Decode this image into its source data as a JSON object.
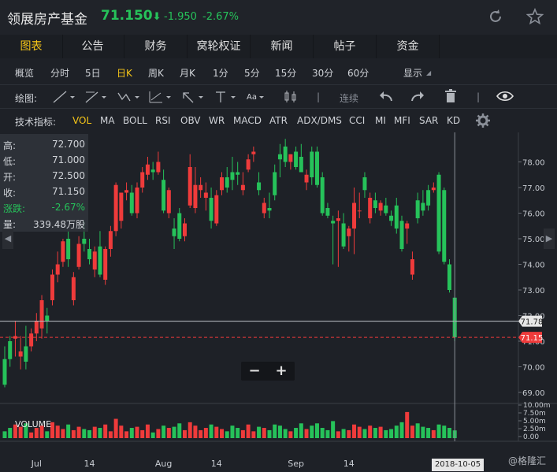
{
  "header": {
    "name": "领展房产基金",
    "price": "71.150",
    "arrow": "⬇",
    "change": "-1.950",
    "change_pct": "-2.67%",
    "refresh_icon": "refresh-icon",
    "star_icon": "star-icon"
  },
  "tabs": [
    {
      "label": "图表",
      "active": true
    },
    {
      "label": "公告"
    },
    {
      "label": "财务"
    },
    {
      "label": "窝轮权证"
    },
    {
      "label": "新闻"
    },
    {
      "label": "帖子"
    },
    {
      "label": "资金"
    }
  ],
  "periods": [
    "概览",
    "分时",
    "5日",
    "日K",
    "周K",
    "月K",
    "1分",
    "5分",
    "15分",
    "30分",
    "60分",
    "显示"
  ],
  "active_period": "日K",
  "draw_toolbar": {
    "label": "绘图:",
    "aa": "Aa",
    "lianxu": "连续"
  },
  "indicators": {
    "label": "技术指标:",
    "items": [
      "VOL",
      "MA",
      "BOLL",
      "RSI",
      "OBV",
      "WR",
      "MACD",
      "ATR",
      "ADX/DMS",
      "CCI",
      "MI",
      "MFI",
      "SAR",
      "KD"
    ],
    "active": "VOL"
  },
  "info": {
    "high_label": "高:",
    "high": "72.700",
    "low_label": "低:",
    "low": "71.000",
    "open_label": "开:",
    "open": "72.500",
    "close_label": "收:",
    "close": "71.150",
    "chg_label": "涨跌:",
    "chg": "-2.67%",
    "vol_label": "量:",
    "vol": "339.48万股"
  },
  "zoom": {
    "minus": "−",
    "plus": "+"
  },
  "volume_label": "VOLUME",
  "crosshair_date": "2018-10-05",
  "watermark": "@格隆汇",
  "colors": {
    "up": "#ef3b3b",
    "down": "#26c25a",
    "accent": "#f5c518",
    "bg": "#1e2127"
  },
  "chart_data": {
    "type": "candlestick",
    "y_ticks": [
      "78.00",
      "77.00",
      "76.00",
      "75.00",
      "74.00",
      "73.00",
      "72.00",
      "71.00",
      "70.00",
      "69.00"
    ],
    "ylim": [
      68.6,
      79.0
    ],
    "price_tags": [
      {
        "value": "71.78",
        "style": "gray"
      },
      {
        "value": "71.15",
        "style": "red"
      }
    ],
    "vol_ticks": [
      "10.00m",
      "7.50m",
      "5.00m",
      "2.50m",
      "0.00"
    ],
    "x_ticks": [
      {
        "label": "Jul",
        "i": 6
      },
      {
        "label": "14",
        "i": 16
      },
      {
        "label": "Aug",
        "i": 30
      },
      {
        "label": "14",
        "i": 40
      },
      {
        "label": "Sep",
        "i": 55
      },
      {
        "label": "14",
        "i": 65
      },
      {
        "label": "14",
        "i": 88
      }
    ],
    "candles": [
      [
        70.3,
        70.8,
        69.2,
        69.3,
        3.0
      ],
      [
        71.0,
        71.2,
        70.0,
        70.3,
        4.5
      ],
      [
        71.1,
        71.8,
        70.4,
        71.2,
        6.0
      ],
      [
        70.4,
        71.2,
        69.9,
        70.6,
        5.0
      ],
      [
        70.8,
        71.6,
        69.9,
        70.2,
        6.5
      ],
      [
        70.8,
        71.5,
        70.6,
        71.3,
        2.5
      ],
      [
        71.3,
        72.1,
        71.0,
        71.8,
        4.5
      ],
      [
        71.5,
        72.8,
        71.1,
        72.6,
        5.5
      ],
      [
        72.0,
        72.3,
        71.3,
        71.8,
        3.0
      ],
      [
        72.6,
        73.8,
        72.4,
        73.6,
        7.0
      ],
      [
        73.6,
        74.5,
        73.3,
        74.0,
        5.5
      ],
      [
        74.1,
        75.0,
        73.9,
        74.9,
        4.0
      ],
      [
        75.0,
        75.3,
        73.9,
        74.2,
        6.0
      ],
      [
        72.6,
        73.7,
        72.4,
        73.5,
        3.5
      ],
      [
        73.9,
        75.1,
        73.8,
        74.8,
        5.0
      ],
      [
        75.0,
        75.7,
        74.5,
        74.8,
        4.0
      ],
      [
        74.6,
        75.0,
        74.0,
        74.2,
        3.5
      ],
      [
        73.8,
        74.7,
        73.5,
        74.5,
        5.0
      ],
      [
        74.7,
        75.3,
        73.5,
        73.6,
        4.5
      ],
      [
        73.4,
        74.7,
        73.2,
        74.6,
        6.0
      ],
      [
        74.6,
        75.5,
        74.3,
        75.3,
        3.0
      ],
      [
        75.3,
        77.2,
        75.1,
        77.1,
        8.5
      ],
      [
        75.7,
        76.8,
        75.4,
        76.8,
        5.5
      ],
      [
        76.8,
        77.2,
        76.5,
        76.9,
        3.0
      ],
      [
        76.8,
        77.1,
        75.9,
        76.0,
        4.5
      ],
      [
        76.0,
        77.2,
        75.8,
        77.0,
        5.0
      ],
      [
        77.0,
        77.8,
        76.8,
        77.6,
        3.5
      ],
      [
        77.5,
        78.2,
        77.3,
        77.9,
        6.0
      ],
      [
        77.7,
        78.0,
        77.3,
        77.6,
        2.5
      ],
      [
        77.6,
        78.4,
        77.5,
        78.0,
        4.0
      ],
      [
        77.3,
        77.7,
        76.0,
        76.1,
        5.5
      ],
      [
        76.0,
        77.0,
        75.8,
        76.9,
        4.5
      ],
      [
        75.4,
        75.8,
        74.6,
        75.1,
        5.0
      ],
      [
        76.0,
        76.2,
        74.9,
        75.0,
        6.5
      ],
      [
        75.1,
        75.8,
        74.9,
        75.6,
        3.5
      ],
      [
        76.3,
        78.3,
        76.2,
        77.8,
        7.0
      ],
      [
        76.2,
        77.8,
        76.0,
        77.1,
        5.5
      ],
      [
        76.9,
        77.4,
        76.6,
        77.1,
        3.5
      ],
      [
        76.6,
        77.2,
        76.1,
        76.8,
        4.5
      ],
      [
        76.6,
        77.0,
        75.4,
        75.7,
        6.0
      ],
      [
        75.6,
        76.9,
        75.5,
        76.7,
        5.0
      ],
      [
        76.9,
        77.6,
        76.7,
        77.4,
        4.0
      ],
      [
        77.4,
        77.8,
        76.8,
        77.0,
        3.0
      ],
      [
        77.6,
        78.2,
        76.9,
        77.3,
        5.5
      ],
      [
        77.6,
        78.0,
        77.1,
        77.5,
        4.5
      ],
      [
        76.9,
        77.6,
        76.7,
        77.1,
        3.5
      ],
      [
        77.7,
        78.3,
        77.6,
        78.1,
        6.0
      ],
      [
        78.3,
        78.6,
        78.0,
        78.4,
        3.0
      ],
      [
        77.2,
        77.6,
        76.7,
        76.9,
        5.0
      ],
      [
        76.0,
        76.6,
        75.8,
        76.4,
        4.5
      ],
      [
        76.2,
        76.8,
        75.8,
        76.1,
        3.5
      ],
      [
        77.6,
        77.9,
        76.5,
        76.7,
        6.0
      ],
      [
        78.3,
        78.7,
        77.4,
        78.1,
        5.5
      ],
      [
        78.6,
        78.9,
        77.8,
        78.0,
        4.0
      ],
      [
        78.0,
        78.3,
        77.7,
        78.3,
        3.0
      ],
      [
        78.4,
        78.6,
        77.7,
        77.8,
        4.5
      ],
      [
        78.2,
        78.7,
        77.6,
        77.6,
        6.5
      ],
      [
        77.2,
        77.7,
        76.9,
        77.5,
        4.0
      ],
      [
        78.4,
        78.6,
        77.1,
        77.4,
        5.5
      ],
      [
        78.4,
        78.6,
        77.0,
        77.1,
        6.5
      ],
      [
        77.4,
        77.6,
        75.9,
        76.0,
        4.5
      ],
      [
        76.2,
        76.4,
        75.8,
        75.9,
        3.5
      ],
      [
        75.7,
        75.9,
        74.0,
        75.6,
        7.5
      ],
      [
        75.7,
        76.1,
        73.9,
        75.8,
        3.0
      ],
      [
        75.6,
        76.0,
        74.6,
        74.7,
        4.0
      ],
      [
        75.1,
        75.5,
        74.5,
        75.4,
        3.5
      ],
      [
        75.4,
        77.0,
        74.4,
        76.4,
        6.0
      ],
      [
        76.1,
        76.8,
        75.8,
        76.1,
        5.0
      ],
      [
        77.4,
        77.6,
        76.6,
        76.9,
        4.0
      ],
      [
        75.8,
        76.8,
        75.6,
        76.6,
        5.5
      ],
      [
        76.5,
        76.8,
        76.0,
        76.2,
        4.5
      ],
      [
        76.1,
        76.5,
        75.9,
        76.4,
        5.0
      ],
      [
        76.3,
        76.6,
        75.9,
        76.0,
        3.5
      ],
      [
        75.9,
        76.1,
        75.5,
        75.7,
        4.0
      ],
      [
        76.3,
        76.6,
        75.2,
        75.4,
        5.5
      ],
      [
        75.7,
        75.9,
        74.5,
        74.6,
        7.0
      ],
      [
        75.4,
        75.7,
        74.8,
        75.6,
        11.5
      ],
      [
        73.6,
        74.5,
        73.4,
        74.2,
        5.5
      ],
      [
        76.5,
        76.8,
        75.6,
        75.8,
        6.5
      ],
      [
        76.4,
        76.9,
        75.9,
        76.1,
        5.0
      ],
      [
        76.9,
        77.1,
        76.1,
        76.3,
        4.5
      ],
      [
        76.9,
        77.2,
        76.8,
        77.0,
        3.5
      ],
      [
        77.5,
        77.6,
        74.4,
        74.5,
        6.0
      ],
      [
        76.9,
        77.0,
        74.0,
        74.1,
        5.5
      ],
      [
        74.0,
        74.2,
        72.9,
        73.0,
        4.5
      ],
      [
        72.7,
        72.7,
        71.0,
        71.15,
        3.4
      ]
    ]
  }
}
